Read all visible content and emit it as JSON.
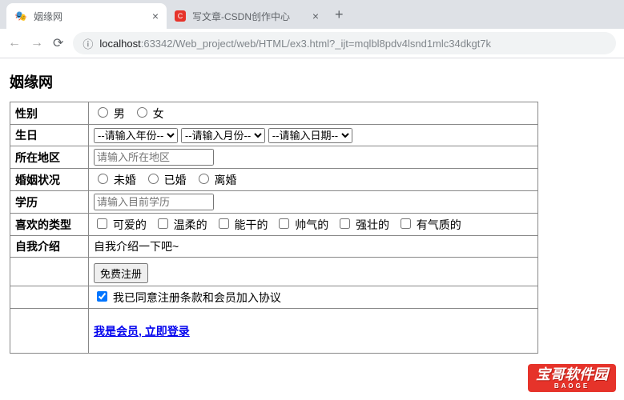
{
  "browser": {
    "tabs": [
      {
        "title": "姻缘网",
        "favicon": "🎭"
      },
      {
        "title": "写文章-CSDN创作中心",
        "favicon": "C"
      }
    ],
    "url_info_icon": "ⓘ",
    "url_host": "localhost",
    "url_port_path": ":63342/Web_project/web/HTML/ex3.html?_ijt=mqlbl8pdv4lsnd1mlc34dkgt7k"
  },
  "page_title": "姻缘网",
  "form": {
    "gender": {
      "label": "性别",
      "options": [
        "男",
        "女"
      ]
    },
    "birthday": {
      "label": "生日",
      "year_placeholder": "--请输入年份--",
      "month_placeholder": "--请输入月份--",
      "day_placeholder": "--请输入日期--"
    },
    "region": {
      "label": "所在地区",
      "placeholder": "请输入所在地区"
    },
    "marriage": {
      "label": "婚姻状况",
      "options": [
        "未婚",
        "已婚",
        "离婚"
      ]
    },
    "education": {
      "label": "学历",
      "placeholder": "请输入目前学历"
    },
    "likes": {
      "label": "喜欢的类型",
      "options": [
        "可爱的",
        "温柔的",
        "能干的",
        "帅气的",
        "强壮的",
        "有气质的"
      ]
    },
    "intro": {
      "label": "自我介绍",
      "placeholder": "自我介绍一下吧~"
    },
    "register_btn": "免费注册",
    "agree": {
      "checked": true,
      "label": "我已同意注册条款和会员加入协议"
    },
    "login_link": "我是会员, 立即登录"
  },
  "watermark": {
    "main": "宝哥软件园",
    "sub": "BAOGE"
  }
}
